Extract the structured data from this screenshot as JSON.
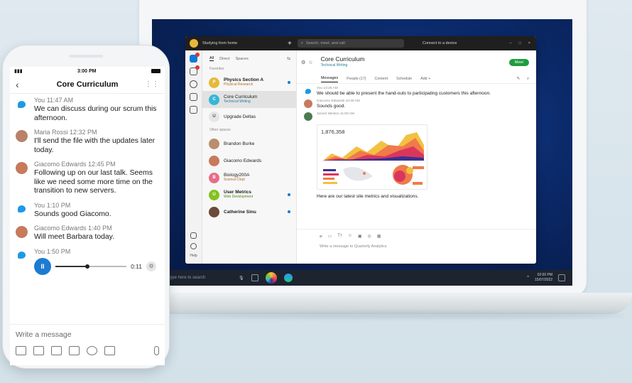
{
  "colors": {
    "accent": "#1d7bd2",
    "meet_green": "#1f9d3f",
    "unread_dot": "#0a7bd8"
  },
  "desktop": {
    "titlebar": {
      "status": "Studying from home",
      "search_placeholder": "Search, meet, and call",
      "connect": "Connect to a device"
    },
    "filters": [
      "All",
      "Direct",
      "Spaces"
    ],
    "sections": {
      "favorites": "Favorites",
      "other": "Other spaces"
    },
    "spaces": [
      {
        "name": "Physics Section A",
        "sub": "Physical Research",
        "initial": "P",
        "color": "#e7b93a",
        "unread": true
      },
      {
        "name": "Core Curriculum",
        "sub": "Technical Writing",
        "initial": "C",
        "color": "#35b7d6",
        "unread": false,
        "selected": true
      },
      {
        "name": "Upgrade Deltas",
        "sub": "",
        "initial": "U",
        "color": "#e6e6e6",
        "unread": false
      },
      {
        "name": "Brandon Burke",
        "sub": "",
        "initial": "",
        "color": "#b98e6e",
        "unread": false
      },
      {
        "name": "Giacomo Edwards",
        "sub": "",
        "initial": "",
        "color": "#c77a5c",
        "unread": false
      },
      {
        "name": "Biology200A",
        "sub": "Science Dept",
        "initial": "B",
        "color": "#e56e8a",
        "unread": false
      },
      {
        "name": "User Metrics",
        "sub": "Web Development",
        "initial": "U",
        "color": "#82c21f",
        "unread": true
      },
      {
        "name": "Catherine Sinu",
        "sub": "",
        "initial": "",
        "color": "#6b4a3a",
        "unread": true
      }
    ],
    "conversation": {
      "title": "Core Curriculum",
      "subtitle": "Technical Writing",
      "meet": "Meet",
      "tabs": [
        "Messages",
        "People (17)",
        "Content",
        "Schedule",
        "Add"
      ],
      "messages": [
        {
          "meta": "You  10:25 AM",
          "text": "We should be able to present the hand-outs to participating customers this afternoon."
        },
        {
          "meta": "Giacomo Edwards  10:30 AM",
          "text": "Sounds good."
        },
        {
          "meta": "James Weston  11:00 AM",
          "text": ""
        }
      ],
      "chart_value": "1,876,358",
      "after_chart": "Here are our latest site metrics and visualizations.",
      "compose_placeholder": "Write a message to Quarterly Analytics"
    },
    "rail": {
      "help": "Help"
    },
    "taskbar": {
      "search": "Type here to search",
      "time": "02:00 PM",
      "date": "15/07/2022"
    }
  },
  "phone": {
    "status_time": "3:00 PM",
    "title": "Core Curriculum",
    "messages": [
      {
        "author": "You",
        "time": "11:47 AM",
        "text": "We can discuss during our scrum this afternoon.",
        "avatar": "you"
      },
      {
        "author": "Maria Rossi",
        "time": "12:32 PM",
        "text": "I'll send the file with the updates later today.",
        "avatar": "#b9826a"
      },
      {
        "author": "Giacomo Edwards",
        "time": "12:45 PM",
        "text": "Following up on our last talk. Seems like we need some more time on the transition to new servers.",
        "avatar": "#c77a5c"
      },
      {
        "author": "You",
        "time": "1:10 PM",
        "text": "Sounds good Giacomo.",
        "avatar": "you"
      },
      {
        "author": "Giacomo Edwards",
        "time": "1:40 PM",
        "text": "Will meet Barbara today.",
        "avatar": "#c77a5c"
      },
      {
        "author": "You",
        "time": "1:50 PM",
        "text": "",
        "avatar": "you"
      }
    ],
    "audio": {
      "duration": "0:11",
      "progress": 0.45,
      "play": "II"
    },
    "compose_placeholder": "Write a message"
  }
}
